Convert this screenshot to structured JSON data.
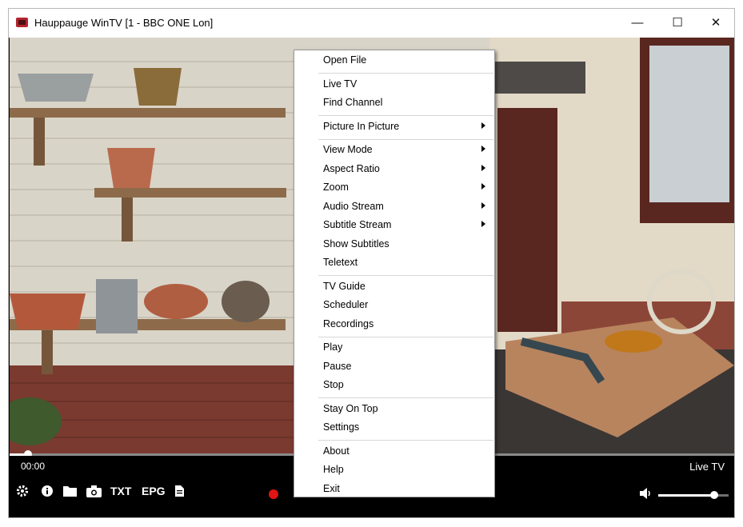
{
  "window": {
    "title": "Hauppauge WinTV [1 - BBC ONE Lon]",
    "minimize_glyph": "—",
    "maximize_glyph": "☐",
    "close_glyph": "✕"
  },
  "player": {
    "time": "00:00",
    "mode": "Live TV",
    "progress_fraction": 0.025,
    "volume_fraction": 0.8
  },
  "toolbar": {
    "items": [
      {
        "icon": "gear-icon"
      },
      {
        "icon": "info-icon"
      },
      {
        "icon": "folder-icon"
      },
      {
        "icon": "camera-icon"
      },
      {
        "label": "TXT"
      },
      {
        "label": "EPG"
      },
      {
        "icon": "document-icon"
      },
      {
        "icon": "record-icon",
        "color": "#e01414"
      },
      {
        "icon": "volume-icon"
      }
    ]
  },
  "context_menu": {
    "groups": [
      [
        {
          "label": "Open File"
        }
      ],
      [
        {
          "label": "Live TV"
        },
        {
          "label": "Find Channel"
        }
      ],
      [
        {
          "label": "Picture In Picture",
          "submenu": true
        }
      ],
      [
        {
          "label": "View Mode",
          "submenu": true
        },
        {
          "label": "Aspect Ratio",
          "submenu": true
        },
        {
          "label": "Zoom",
          "submenu": true
        },
        {
          "label": "Audio Stream",
          "submenu": true
        },
        {
          "label": "Subtitle Stream",
          "submenu": true
        },
        {
          "label": "Show Subtitles"
        },
        {
          "label": "Teletext"
        }
      ],
      [
        {
          "label": "TV Guide"
        },
        {
          "label": "Scheduler"
        },
        {
          "label": "Recordings"
        }
      ],
      [
        {
          "label": "Play"
        },
        {
          "label": "Pause"
        },
        {
          "label": "Stop"
        }
      ],
      [
        {
          "label": "Stay On Top"
        },
        {
          "label": "Settings"
        }
      ],
      [
        {
          "label": "About"
        },
        {
          "label": "Help"
        },
        {
          "label": "Exit"
        }
      ]
    ]
  }
}
